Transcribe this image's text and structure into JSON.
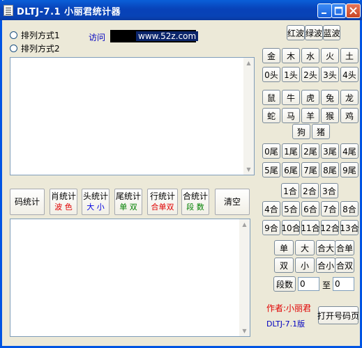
{
  "window": {
    "title": "DLTJ-7.1 小丽君统计器"
  },
  "options": {
    "sort1": "排列方式1",
    "sort2": "排列方式2"
  },
  "visit": {
    "label": "访问",
    "url": "www.52z.com"
  },
  "top_buttons": [
    "红波",
    "绿波",
    "蓝波"
  ],
  "elements": [
    "金",
    "木",
    "水",
    "火",
    "土"
  ],
  "heads": [
    "0头",
    "1头",
    "2头",
    "3头",
    "4头"
  ],
  "zodiac_row1": [
    "鼠",
    "牛",
    "虎",
    "兔",
    "龙"
  ],
  "zodiac_row2": [
    "蛇",
    "马",
    "羊",
    "猴",
    "鸡"
  ],
  "zodiac_row3": [
    "狗",
    "猪"
  ],
  "tails_row1": [
    "0尾",
    "1尾",
    "2尾",
    "3尾",
    "4尾"
  ],
  "tails_row2": [
    "5尾",
    "6尾",
    "7尾",
    "8尾",
    "9尾"
  ],
  "he_row1": [
    "1合",
    "2合",
    "3合"
  ],
  "he_row2": [
    "4合",
    "5合",
    "6合",
    "7合",
    "8合"
  ],
  "he_row3": [
    "9合",
    "10合",
    "11合",
    "12合",
    "13合"
  ],
  "parity_row1": [
    "单",
    "大",
    "合大",
    "合单"
  ],
  "parity_row2": [
    "双",
    "小",
    "合小",
    "合双"
  ],
  "segment": {
    "label": "段数",
    "from": "0",
    "to_label": "至",
    "to": "0"
  },
  "stat_buttons": {
    "code": "码统计",
    "xiao": {
      "label": "肖统计",
      "sub": "波 色",
      "color": "#e00000"
    },
    "tou": {
      "label": "头统计",
      "sub": "大 小",
      "color": "#0000e0"
    },
    "wei": {
      "label": "尾统计",
      "sub": "单 双",
      "color": "#008000"
    },
    "hang": {
      "label": "行统计",
      "sub": "合单双",
      "color": "#e00000"
    },
    "he": {
      "label": "合统计",
      "sub": "段 数",
      "color": "#008000"
    },
    "clear": "清空"
  },
  "author": {
    "text": "作者:小丽君",
    "color": "#e00000"
  },
  "version": {
    "text": "DLTJ-7.1版",
    "color": "#0000c0"
  },
  "open_button": "打开号码页"
}
